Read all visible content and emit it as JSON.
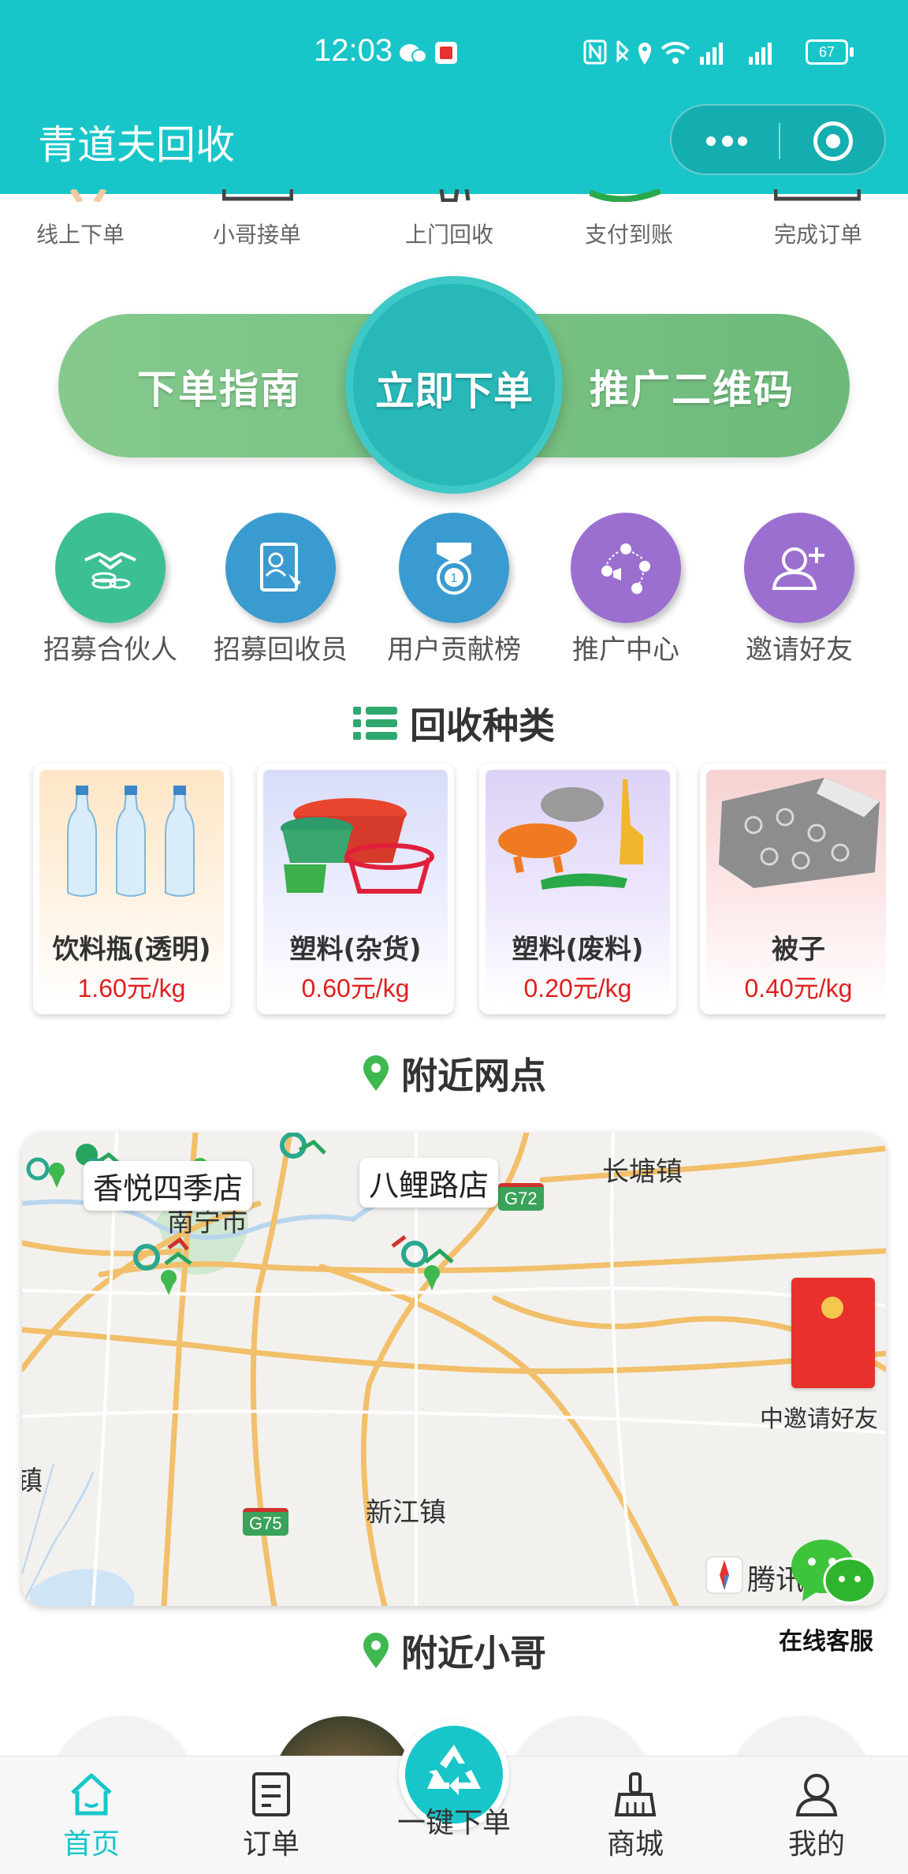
{
  "status_bar": {
    "time": "12:03",
    "battery": "67"
  },
  "header": {
    "title": "青道夫回收"
  },
  "steps": [
    "线上下单",
    "小哥接单",
    "上门回收",
    "支付到账",
    "完成订单"
  ],
  "pill": {
    "left": "下单指南",
    "center": "立即下单",
    "right": "推广二维码"
  },
  "features": [
    {
      "label": "招募合伙人",
      "icon": "handshake-icon",
      "color": "#3dbf96"
    },
    {
      "label": "招募回收员",
      "icon": "resume-icon",
      "color": "#3a9bd0"
    },
    {
      "label": "用户贡献榜",
      "icon": "medal-icon",
      "color": "#3a9bd0"
    },
    {
      "label": "推广中心",
      "icon": "share-network-icon",
      "color": "#9b6fd0"
    },
    {
      "label": "邀请好友",
      "icon": "add-user-icon",
      "color": "#9b6fd0"
    }
  ],
  "sections": {
    "categories": "回收种类",
    "nearby_stations": "附近网点",
    "nearby_couriers": "附近小哥"
  },
  "categories": [
    {
      "name": "饮料瓶(透明)",
      "price": "1.60元/kg"
    },
    {
      "name": "塑料(杂货)",
      "price": "0.60元/kg"
    },
    {
      "name": "塑料(废料)",
      "price": "0.20元/kg"
    },
    {
      "name": "被子",
      "price": "0.40元/kg"
    }
  ],
  "map": {
    "stores": [
      "香悦四季店",
      "八鲤路店"
    ],
    "places": {
      "city": "南宁市",
      "town1": "长塘镇",
      "town2": "新江镇",
      "edge": "镇",
      "invite": "中邀请好友"
    },
    "roads": [
      "G72",
      "G75"
    ],
    "provider": "腾讯"
  },
  "customer_service": {
    "label": "在线客服"
  },
  "tabbar": {
    "home": "首页",
    "orders": "订单",
    "quick_order": "一键下单",
    "mall": "商城",
    "mine": "我的"
  },
  "colors": {
    "primary": "#18c6c9",
    "green": "#6dba7b",
    "price_red": "#e02020"
  }
}
